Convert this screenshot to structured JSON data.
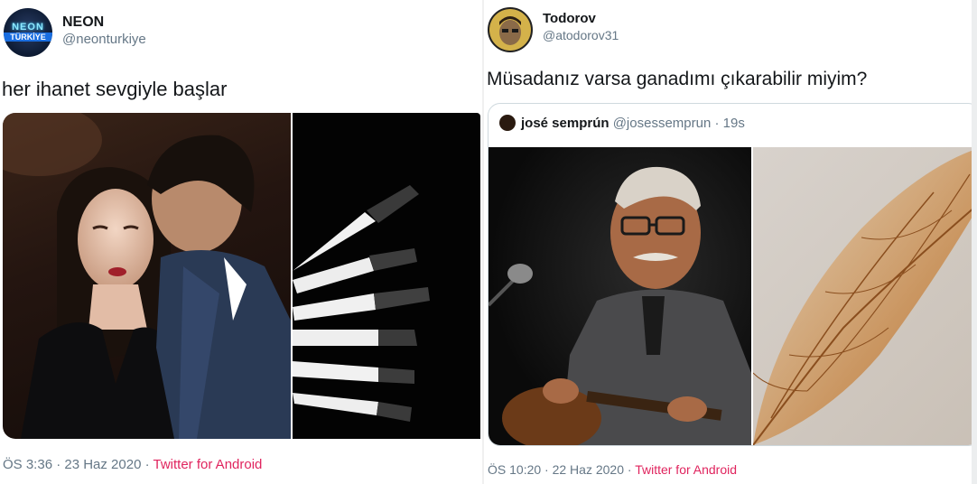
{
  "tweets": [
    {
      "name": "NEON",
      "handle": "@neonturkiye",
      "avatar_text_line1": "NEON",
      "avatar_text_line2": "TÜRKİYE",
      "text": "her ihanet sevgiyle başlar",
      "time": "ÖS 3:36 · 23 Haz 2020 · ",
      "source": "Twitter for Android"
    },
    {
      "name": "Todorov",
      "handle": "@atodorov31",
      "text": "Müsadanız varsa ganadımı çıkarabilir miyim?",
      "quoted": {
        "name": "josé semprún",
        "handle": "@josessemprun",
        "time": " · 19s"
      },
      "time": "ÖS 10:20 · 22 Haz 2020 · ",
      "source": "Twitter for Android"
    }
  ],
  "colors": {
    "source_link": "#e0245e",
    "secondary_text": "#657786",
    "primary_text": "#14171a",
    "quote_border": "#cfd9de"
  }
}
